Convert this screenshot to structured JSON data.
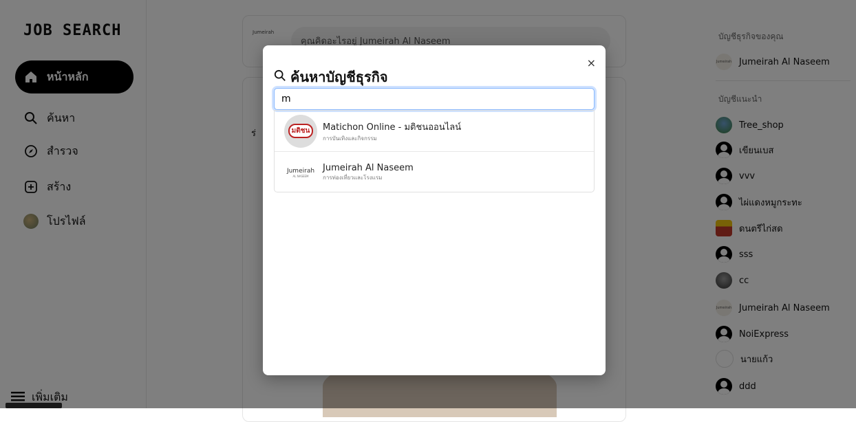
{
  "sidebar": {
    "logo": "JOB SEARCH",
    "items": [
      {
        "label": "หน้าหลัก",
        "icon": "home-icon"
      },
      {
        "label": "ค้นหา",
        "icon": "search-icon"
      },
      {
        "label": "สำรวจ",
        "icon": "compass-icon"
      },
      {
        "label": "สร้าง",
        "icon": "plus-square-icon"
      },
      {
        "label": "โปรไฟล์",
        "icon": "avatar"
      }
    ],
    "more_label": "เพิ่มเติม"
  },
  "composer": {
    "logo_text": "Jumeirah",
    "placeholder": "คุณคิดอะไรอยู่ Jumeirah Al Naseem"
  },
  "post": {
    "author_initial": "ร่"
  },
  "rightbar": {
    "my_accounts_title": "บัญชีธุรกิจของคุณ",
    "my_account": "Jumeirah Al Naseem",
    "suggested_title": "บัญชีแนะนำ",
    "suggested": [
      {
        "name": "Tree_shop"
      },
      {
        "name": "เขียนเบส"
      },
      {
        "name": "vvv"
      },
      {
        "name": "ไผ่แดงหมูกระทะ"
      },
      {
        "name": "ดนตรีไก่สด"
      },
      {
        "name": "sss"
      },
      {
        "name": "cc"
      },
      {
        "name": "Jumeirah Al Naseem"
      },
      {
        "name": "NoiExpress"
      },
      {
        "name": "นายแก้ว"
      },
      {
        "name": "ddd"
      }
    ]
  },
  "modal": {
    "title": "ค้นหาบัญชีธุรกิจ",
    "close": "×",
    "search_value": "m",
    "results": [
      {
        "name": "Matichon Online - มติชนออนไลน์",
        "category": "การบันเทิงและกิจกรรม",
        "logo_text": "มติชน"
      },
      {
        "name": "Jumeirah Al Naseem",
        "category": "การท่องเที่ยวและโรงแรม",
        "logo_text": "Jumeirah",
        "logo_sub": "AL NASEEM"
      }
    ]
  },
  "colors": {
    "accent": "#000000",
    "focus": "#86b7fe",
    "overlay": "rgba(0,0,0,0.5)"
  }
}
